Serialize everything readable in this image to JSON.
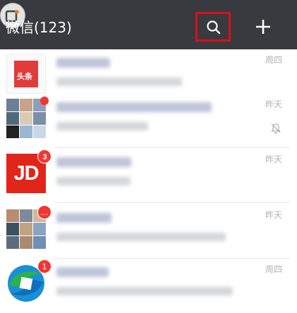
{
  "header": {
    "title": "微信(123)",
    "search_icon": "search-icon",
    "add_icon": "plus-icon",
    "corner_icon": "screen-record-icon",
    "bg_color": "#393a3f",
    "highlight_color": "#d8101b"
  },
  "chats": [
    {
      "avatar": "toutiao-logo",
      "avatar_text": "头条",
      "badge": "",
      "has_dot": false,
      "time": "周四",
      "muted": false
    },
    {
      "avatar": "group-grid",
      "badge": "",
      "has_dot": true,
      "time": "昨天",
      "muted": true
    },
    {
      "avatar": "jd-logo",
      "avatar_text": "JD",
      "badge": "3",
      "has_dot": false,
      "time": "昨天",
      "muted": false
    },
    {
      "avatar": "group-grid",
      "badge": "...",
      "has_dot": false,
      "time": "昨天",
      "muted": false
    },
    {
      "avatar": "round-logo",
      "badge": "1",
      "has_dot": false,
      "time": "周四",
      "muted": false
    }
  ]
}
